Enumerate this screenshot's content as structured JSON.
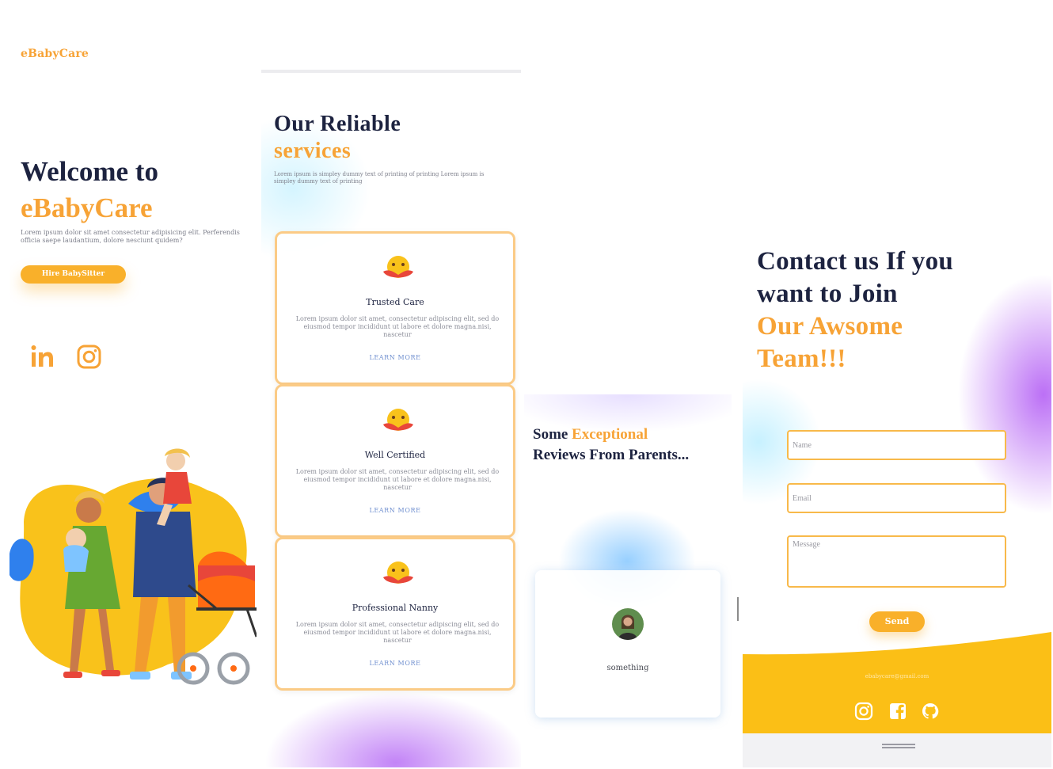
{
  "hero": {
    "logo": "eBabyCare",
    "title_line1": "Welcome to",
    "title_accent": "eBabyCare",
    "text": "Lorem ipsum dolor sit amet consectetur adipisicing elit. Perferendis officia saepe laudantium, dolore nesciunt quidem?",
    "hire_button": "Hire BabySitter",
    "social_icons": [
      "linkedin-icon",
      "instagram-icon"
    ]
  },
  "services": {
    "title_line1": "Our Reliable",
    "title_accent": "services",
    "text": "Lorem ipsum is simpley dummy text of printing of printing Lorem ipsum is simpley dummy text of printing",
    "cards": [
      {
        "name": "Trusted Care",
        "desc": "Lorem ipsum dolor sit amet, consectetur adipiscing elit, sed do eiusmod tempor incididunt ut labore et dolore magna.nisi, nascetur",
        "link": "LEARN MORE"
      },
      {
        "name": "Well Certified",
        "desc": "Lorem ipsum dolor sit amet, consectetur adipiscing elit, sed do eiusmod tempor incididunt ut labore et dolore magna.nisi, nascetur",
        "link": "LEARN MORE"
      },
      {
        "name": "Professional Nanny",
        "desc": "Lorem ipsum dolor sit amet, consectetur adipiscing elit, sed do eiusmod tempor incididunt ut labore et dolore magna.nisi, nascetur",
        "link": "LEARN MORE"
      }
    ]
  },
  "reviews": {
    "title_part1": "Some ",
    "title_accent": "Exceptional",
    "title_line2": "Reviews From Parents...",
    "review_text": "something"
  },
  "contact": {
    "title_line1": "Contact us If you",
    "title_line2": "want to Join",
    "title_accent1": "Our Awsome",
    "title_accent2": "Team!!!",
    "name_placeholder": "Name",
    "email_placeholder": "Email",
    "message_placeholder": "Message",
    "send_button": "Send",
    "footer_email": "ebabycare@gmail.com",
    "footer_icons": [
      "instagram-icon",
      "facebook-icon",
      "github-icon"
    ]
  },
  "colors": {
    "accent": "#f7a336",
    "button": "#f9b02a",
    "footer": "#fbbf16",
    "heading": "#1d2340",
    "purple_glow": "#b868f5",
    "blue_glow": "#7ec4ff"
  }
}
